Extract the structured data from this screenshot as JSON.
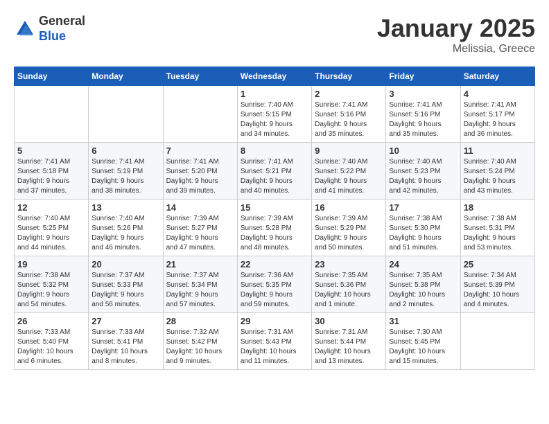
{
  "header": {
    "logo_general": "General",
    "logo_blue": "Blue",
    "calendar_title": "January 2025",
    "calendar_subtitle": "Melissia, Greece"
  },
  "days_of_week": [
    "Sunday",
    "Monday",
    "Tuesday",
    "Wednesday",
    "Thursday",
    "Friday",
    "Saturday"
  ],
  "weeks": [
    [
      {
        "day": "",
        "info": ""
      },
      {
        "day": "",
        "info": ""
      },
      {
        "day": "",
        "info": ""
      },
      {
        "day": "1",
        "info": "Sunrise: 7:40 AM\nSunset: 5:15 PM\nDaylight: 9 hours\nand 34 minutes."
      },
      {
        "day": "2",
        "info": "Sunrise: 7:41 AM\nSunset: 5:16 PM\nDaylight: 9 hours\nand 35 minutes."
      },
      {
        "day": "3",
        "info": "Sunrise: 7:41 AM\nSunset: 5:16 PM\nDaylight: 9 hours\nand 35 minutes."
      },
      {
        "day": "4",
        "info": "Sunrise: 7:41 AM\nSunset: 5:17 PM\nDaylight: 9 hours\nand 36 minutes."
      }
    ],
    [
      {
        "day": "5",
        "info": "Sunrise: 7:41 AM\nSunset: 5:18 PM\nDaylight: 9 hours\nand 37 minutes."
      },
      {
        "day": "6",
        "info": "Sunrise: 7:41 AM\nSunset: 5:19 PM\nDaylight: 9 hours\nand 38 minutes."
      },
      {
        "day": "7",
        "info": "Sunrise: 7:41 AM\nSunset: 5:20 PM\nDaylight: 9 hours\nand 39 minutes."
      },
      {
        "day": "8",
        "info": "Sunrise: 7:41 AM\nSunset: 5:21 PM\nDaylight: 9 hours\nand 40 minutes."
      },
      {
        "day": "9",
        "info": "Sunrise: 7:40 AM\nSunset: 5:22 PM\nDaylight: 9 hours\nand 41 minutes."
      },
      {
        "day": "10",
        "info": "Sunrise: 7:40 AM\nSunset: 5:23 PM\nDaylight: 9 hours\nand 42 minutes."
      },
      {
        "day": "11",
        "info": "Sunrise: 7:40 AM\nSunset: 5:24 PM\nDaylight: 9 hours\nand 43 minutes."
      }
    ],
    [
      {
        "day": "12",
        "info": "Sunrise: 7:40 AM\nSunset: 5:25 PM\nDaylight: 9 hours\nand 44 minutes."
      },
      {
        "day": "13",
        "info": "Sunrise: 7:40 AM\nSunset: 5:26 PM\nDaylight: 9 hours\nand 46 minutes."
      },
      {
        "day": "14",
        "info": "Sunrise: 7:39 AM\nSunset: 5:27 PM\nDaylight: 9 hours\nand 47 minutes."
      },
      {
        "day": "15",
        "info": "Sunrise: 7:39 AM\nSunset: 5:28 PM\nDaylight: 9 hours\nand 48 minutes."
      },
      {
        "day": "16",
        "info": "Sunrise: 7:39 AM\nSunset: 5:29 PM\nDaylight: 9 hours\nand 50 minutes."
      },
      {
        "day": "17",
        "info": "Sunrise: 7:38 AM\nSunset: 5:30 PM\nDaylight: 9 hours\nand 51 minutes."
      },
      {
        "day": "18",
        "info": "Sunrise: 7:38 AM\nSunset: 5:31 PM\nDaylight: 9 hours\nand 53 minutes."
      }
    ],
    [
      {
        "day": "19",
        "info": "Sunrise: 7:38 AM\nSunset: 5:32 PM\nDaylight: 9 hours\nand 54 minutes."
      },
      {
        "day": "20",
        "info": "Sunrise: 7:37 AM\nSunset: 5:33 PM\nDaylight: 9 hours\nand 56 minutes."
      },
      {
        "day": "21",
        "info": "Sunrise: 7:37 AM\nSunset: 5:34 PM\nDaylight: 9 hours\nand 57 minutes."
      },
      {
        "day": "22",
        "info": "Sunrise: 7:36 AM\nSunset: 5:35 PM\nDaylight: 9 hours\nand 59 minutes."
      },
      {
        "day": "23",
        "info": "Sunrise: 7:35 AM\nSunset: 5:36 PM\nDaylight: 10 hours\nand 1 minute."
      },
      {
        "day": "24",
        "info": "Sunrise: 7:35 AM\nSunset: 5:38 PM\nDaylight: 10 hours\nand 2 minutes."
      },
      {
        "day": "25",
        "info": "Sunrise: 7:34 AM\nSunset: 5:39 PM\nDaylight: 10 hours\nand 4 minutes."
      }
    ],
    [
      {
        "day": "26",
        "info": "Sunrise: 7:33 AM\nSunset: 5:40 PM\nDaylight: 10 hours\nand 6 minutes."
      },
      {
        "day": "27",
        "info": "Sunrise: 7:33 AM\nSunset: 5:41 PM\nDaylight: 10 hours\nand 8 minutes."
      },
      {
        "day": "28",
        "info": "Sunrise: 7:32 AM\nSunset: 5:42 PM\nDaylight: 10 hours\nand 9 minutes."
      },
      {
        "day": "29",
        "info": "Sunrise: 7:31 AM\nSunset: 5:43 PM\nDaylight: 10 hours\nand 11 minutes."
      },
      {
        "day": "30",
        "info": "Sunrise: 7:31 AM\nSunset: 5:44 PM\nDaylight: 10 hours\nand 13 minutes."
      },
      {
        "day": "31",
        "info": "Sunrise: 7:30 AM\nSunset: 5:45 PM\nDaylight: 10 hours\nand 15 minutes."
      },
      {
        "day": "",
        "info": ""
      }
    ]
  ]
}
